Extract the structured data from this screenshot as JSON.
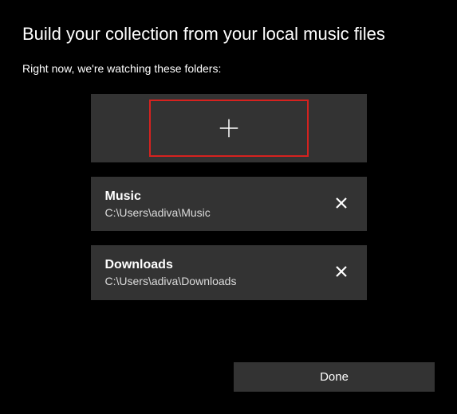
{
  "dialog": {
    "title": "Build your collection from your local music files",
    "subtitle": "Right now, we're watching these folders:",
    "add_icon": "plus-icon",
    "folders": [
      {
        "name": "Music",
        "path": "C:\\Users\\adiva\\Music"
      },
      {
        "name": "Downloads",
        "path": "C:\\Users\\adiva\\Downloads"
      }
    ],
    "done_label": "Done",
    "highlight_color": "#d6221f"
  }
}
